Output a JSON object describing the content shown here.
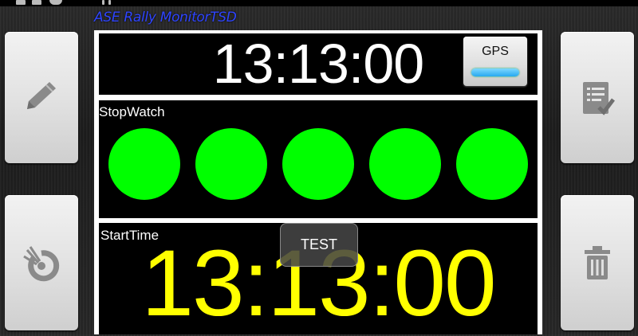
{
  "app": {
    "title": "ASE Rally MonitorTSD"
  },
  "clock": {
    "time": "13:13:00"
  },
  "gps": {
    "label": "GPS",
    "indicator_color": "#27a8f0"
  },
  "stopwatch": {
    "label": "StopWatch",
    "lamps": [
      "#00ff00",
      "#00ff00",
      "#00ff00",
      "#00ff00",
      "#00ff00"
    ]
  },
  "start_time": {
    "label": "StartTime",
    "time": "13:13:00",
    "color": "#ffff00"
  },
  "toast": {
    "text": "TEST"
  },
  "side_buttons": {
    "left": [
      "pencil-icon",
      "reset-icon"
    ],
    "right": [
      "checklist-icon",
      "trash-icon"
    ]
  },
  "colors": {
    "title": "#2f45ff",
    "lamp_on": "#00ff00",
    "clock": "#ffffff"
  }
}
